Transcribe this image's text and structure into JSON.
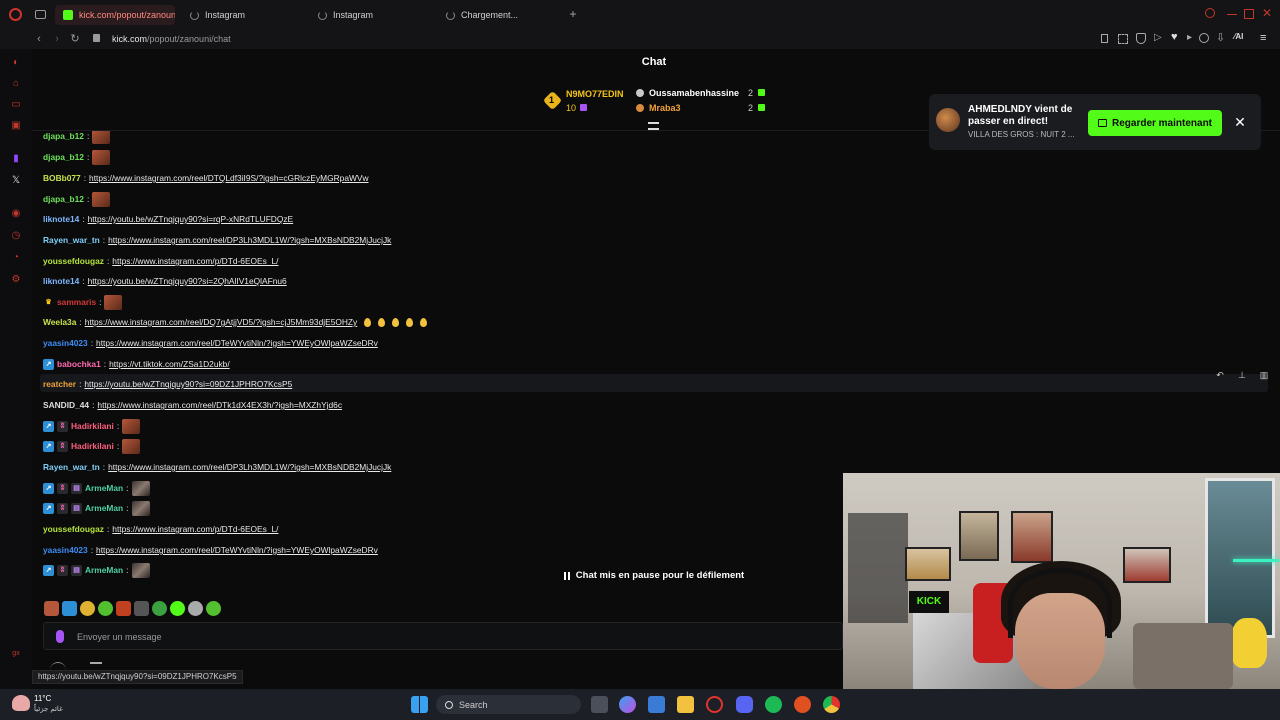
{
  "browser": {
    "tabs": [
      {
        "label": "kick.com/popout/zanouni/",
        "active": true
      },
      {
        "label": "Instagram",
        "active": false
      },
      {
        "label": "Instagram",
        "active": false
      },
      {
        "label": "Chargement...",
        "active": false
      }
    ],
    "url_host": "kick.com",
    "url_path": "/popout/zanouni/chat",
    "status_url": "https://youtu.be/wZTnqjquy90?si=09DZ1JPHRO7KcsP5"
  },
  "chat": {
    "title": "Chat",
    "top_gifters": [
      {
        "rank": "1",
        "name": "N9MO77EDIN",
        "count": "10"
      },
      {
        "name": "Oussamabenhassine",
        "count": "2"
      },
      {
        "name": "Mraba3",
        "count": "2"
      }
    ],
    "messages": [
      {
        "user": "djapa_b12",
        "color": "#6ee15a",
        "text": "",
        "emote": true
      },
      {
        "user": "djapa_b12",
        "color": "#6ee15a",
        "text": "",
        "emote": true
      },
      {
        "user": "BOBb077",
        "color": "#c6e34e",
        "text": "https://www.instagram.com/reel/DTQLdf3iI9S/?igsh=cGRlczEyMGRpaWVw"
      },
      {
        "user": "djapa_b12",
        "color": "#6ee15a",
        "text": "",
        "emote": true
      },
      {
        "user": "liknote14",
        "color": "#7fb8ff",
        "text": "https://youtu.be/wZTnqjquy90?si=rqP-xNRdTLUFDQzE"
      },
      {
        "user": "Rayen_war_tn",
        "color": "#7fd0f7",
        "text": "https://www.instagram.com/reel/DP3Lh3MDL1W/?igsh=MXBsNDB2MjJucjJk"
      },
      {
        "user": "youssefdougaz",
        "color": "#b6e63c",
        "text": "https://www.instagram.com/p/DTd-6EOEs_L/"
      },
      {
        "user": "liknote14",
        "color": "#7fb8ff",
        "text": "https://youtu.be/wZTnqjquy90?si=2QhAlIV1eQlAFnu6"
      },
      {
        "user": "sammaris",
        "color": "#d43838",
        "text": "",
        "emote": true
      },
      {
        "user": "Weela3a",
        "color": "#c6e34e",
        "text": "https://www.instagram.com/reel/DQ7gAtjjVD5/?igsh=cjJ5Mm93djE5OHZy"
      },
      {
        "user": "yaasin4023",
        "color": "#3d8df5",
        "text": "https://www.instagram.com/reel/DTeWYvtiNln/?igsh=YWEyOWlpaWZseDRv"
      },
      {
        "user": "babochka1",
        "color": "#ff6ab0",
        "text": "https://vt.tiktok.com/ZSa1D2ukb/"
      },
      {
        "user": "reatcher",
        "color": "#f0a23c",
        "text": "https://youtu.be/wZTnqjquy90?si=09DZ1JPHRO7KcsP5"
      },
      {
        "user": "SANDID_44",
        "color": "#dedede",
        "text": "https://www.instagram.com/reel/DTk1dX4EX3h/?igsh=MXZhYjd6c"
      },
      {
        "user": "Hadirkilani",
        "color": "#ff5f7e",
        "text": "",
        "emote": true
      },
      {
        "user": "Hadirkilani",
        "color": "#ff5f7e",
        "text": "",
        "emote": true
      },
      {
        "user": "Rayen_war_tn",
        "color": "#7fd0f7",
        "text": "https://www.instagram.com/reel/DP3Lh3MDL1W/?igsh=MXBsNDB2MjJucjJk"
      },
      {
        "user": "ArmeMan",
        "color": "#4fd1a3",
        "text": "",
        "emote": true
      },
      {
        "user": "ArmeMan",
        "color": "#4fd1a3",
        "text": "",
        "emote": true
      },
      {
        "user": "youssefdougaz",
        "color": "#b6e63c",
        "text": "https://www.instagram.com/p/DTd-6EOEs_L/"
      },
      {
        "user": "yaasin4023",
        "color": "#3d8df5",
        "text": "https://www.instagram.com/reel/DTeWYvtiNln/?igsh=YWEyOWlpaWZseDRv"
      },
      {
        "user": "ArmeMan",
        "color": "#4fd1a3",
        "text": "",
        "emote": true
      }
    ],
    "paused_banner": "Chat mis en pause pour le défilement",
    "input_placeholder": "Envoyer un message"
  },
  "notification": {
    "title": "AHMEDLNDY vient de passer en direct!",
    "subtitle": "VILLA DES GROS : NUIT 2 ...",
    "button_label": "Regarder maintenant",
    "close_label": "✕"
  },
  "taskbar": {
    "weather_temp": "11°C",
    "weather_desc": "غائم جزئياً",
    "search_label": "Search"
  },
  "colors": {
    "accent_green": "#53fc18",
    "background": "#0b0b0c"
  }
}
